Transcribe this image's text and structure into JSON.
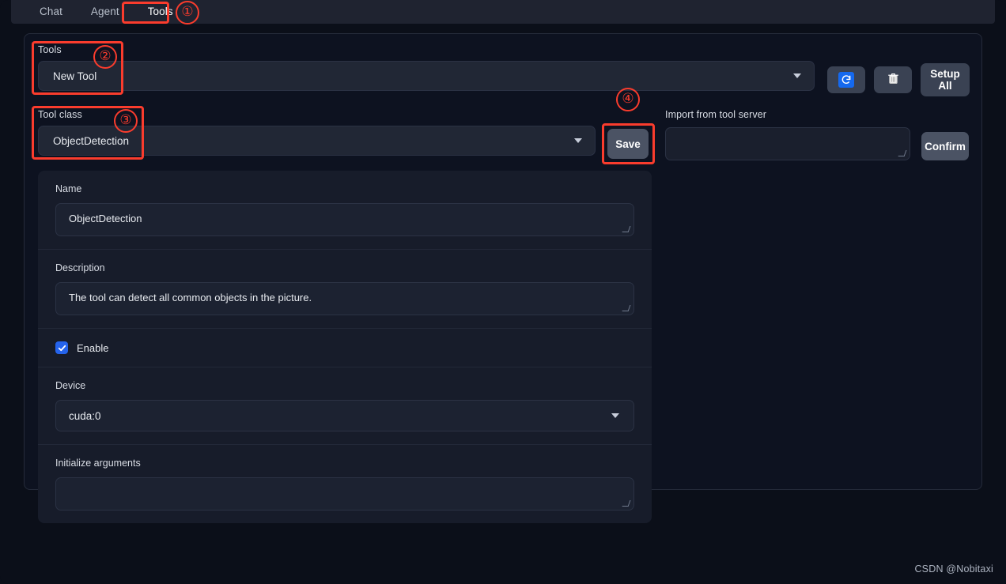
{
  "tabs": [
    {
      "label": "Chat",
      "active": false
    },
    {
      "label": "Agent",
      "active": false
    },
    {
      "label": "Tools",
      "active": true
    }
  ],
  "tools_section": {
    "label": "Tools",
    "selected": "New Tool",
    "caret_icon": "chevron-down-icon"
  },
  "toolbar": {
    "refresh_icon": "refresh-icon",
    "delete_icon": "trash-icon",
    "setup_all_label": "Setup\nAll",
    "setup_all_line1": "Setup",
    "setup_all_line2": "All"
  },
  "tool_class_section": {
    "label": "Tool class",
    "selected": "ObjectDetection",
    "caret_icon": "chevron-down-icon"
  },
  "save_button": {
    "label": "Save"
  },
  "import_section": {
    "label": "Import from tool server",
    "value": "",
    "confirm_label": "Confirm"
  },
  "form": {
    "name": {
      "label": "Name",
      "value": "ObjectDetection"
    },
    "description": {
      "label": "Description",
      "value": "The tool can detect all common objects in the picture."
    },
    "enable": {
      "label": "Enable",
      "checked": true
    },
    "device": {
      "label": "Device",
      "value": "cuda:0",
      "caret_icon": "chevron-down-icon"
    },
    "initialize_arguments": {
      "label": "Initialize arguments",
      "value": ""
    }
  },
  "annotations": [
    {
      "number": "①"
    },
    {
      "number": "②"
    },
    {
      "number": "③"
    },
    {
      "number": "④"
    }
  ],
  "watermark": "CSDN @Nobitaxi",
  "colors": {
    "page_bg": "#0b0f19",
    "tabbar_bg": "#1f2330",
    "panel_bg": "#0d1220",
    "card_bg": "#171c2a",
    "accent_blue": "#2563eb",
    "annotation_red": "#fa3c2d",
    "button_grey": "#4b5364"
  }
}
